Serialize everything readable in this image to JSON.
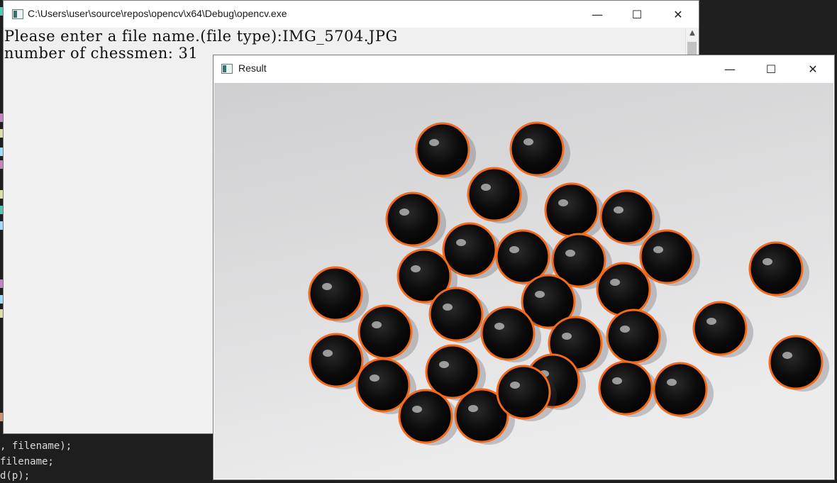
{
  "editor": {
    "code_lines": [
      {
        "text": ", filename);"
      },
      {
        "text": "filename;"
      },
      {
        "text": "d(p);"
      }
    ],
    "marks": [
      {
        "color": "#4ec9b0"
      },
      {
        "color": "#c586c0"
      },
      {
        "color": "#dcdcaa"
      },
      {
        "color": "#9cdcfe"
      },
      {
        "color": "#c586c0"
      },
      {
        "color": "#dcdcaa"
      },
      {
        "color": "#4ec9b0"
      },
      {
        "color": "#9cdcfe"
      },
      {
        "color": "#c586c0"
      },
      {
        "color": "#9cdcfe"
      },
      {
        "color": "#dcdcaa"
      },
      {
        "color": "#ce9178"
      }
    ]
  },
  "console": {
    "title": "C:\\Users\\user\\source\\repos\\opencv\\x64\\Debug\\opencv.exe",
    "icon": "console-window-icon",
    "lines": [
      {
        "text": "Please enter a file name.(file type):IMG_5704.JPG"
      },
      {
        "text": "number of chessmen: 31"
      }
    ],
    "controls": {
      "minimize": "—",
      "maximize": "☐",
      "close": "✕"
    },
    "scroll_up_glyph": "▲"
  },
  "result": {
    "title": "Result",
    "icon": "image-window-icon",
    "controls": {
      "minimize": "—",
      "maximize": "☐",
      "close": "✕"
    },
    "image": {
      "background_top": "#cfcfd1",
      "background_bottom": "#ececed",
      "piece_color": "#0c0c0c",
      "circle_color": "#f26a1b",
      "pieces_count": 31
    }
  }
}
